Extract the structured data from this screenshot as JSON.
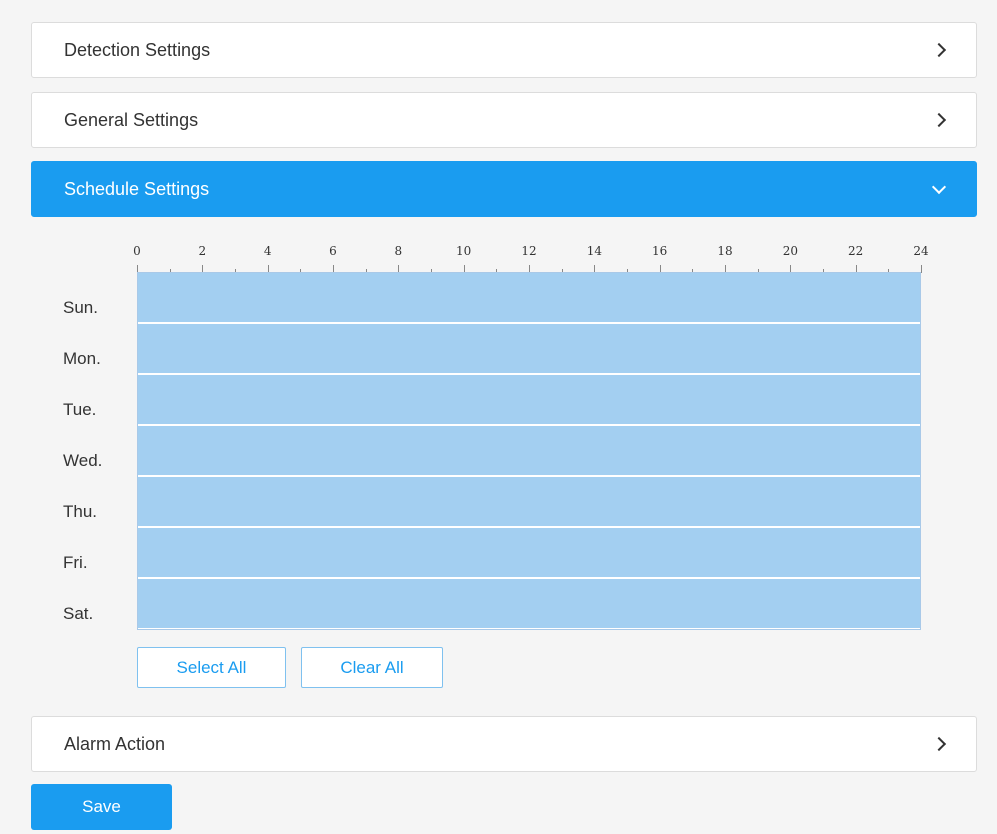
{
  "panels": {
    "detection": {
      "title": "Detection Settings"
    },
    "general": {
      "title": "General Settings"
    },
    "schedule": {
      "title": "Schedule Settings"
    },
    "alarm": {
      "title": "Alarm Action"
    }
  },
  "schedule": {
    "ticks": [
      "0",
      "2",
      "4",
      "6",
      "8",
      "10",
      "12",
      "14",
      "16",
      "18",
      "20",
      "22",
      "24"
    ],
    "days": [
      "Sun.",
      "Mon.",
      "Tue.",
      "Wed.",
      "Thu.",
      "Fri.",
      "Sat."
    ],
    "selected_hours": [
      [
        0,
        24
      ],
      [
        0,
        24
      ],
      [
        0,
        24
      ],
      [
        0,
        24
      ],
      [
        0,
        24
      ],
      [
        0,
        24
      ],
      [
        0,
        24
      ]
    ],
    "select_all_label": "Select All",
    "clear_all_label": "Clear All"
  },
  "save_label": "Save",
  "colors": {
    "accent": "#1a9cf0",
    "selected_fill": "#a3cff1",
    "background": "#f5f5f5"
  },
  "icons": {
    "collapsed": "chevron-right-icon",
    "expanded": "chevron-down-icon"
  }
}
